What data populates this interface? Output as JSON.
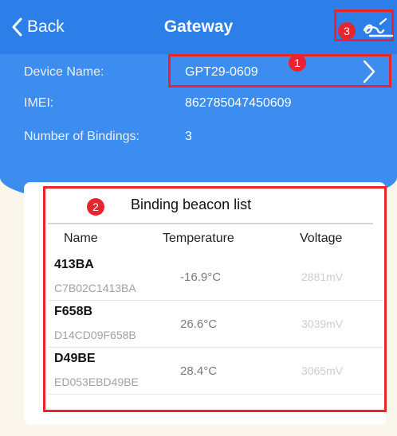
{
  "header": {
    "back_label": "Back",
    "title": "Gateway"
  },
  "callouts": {
    "one": "1",
    "two": "2",
    "three": "3"
  },
  "device": {
    "name_label": "Device Name:",
    "name_value": "GPT29-0609",
    "imei_label": "IMEI:",
    "imei_value": "862785047450609",
    "bindings_label": "Number of Bindings:",
    "bindings_value": "3"
  },
  "beacon_list": {
    "title": "Binding beacon list",
    "columns": [
      "Name",
      "Temperature",
      "Voltage"
    ],
    "rows": [
      {
        "name": "413BA",
        "mac": "C7B02C1413BA",
        "temperature": "-16.9°C",
        "voltage": "2881mV"
      },
      {
        "name": "F658B",
        "mac": "D14CD09F658B",
        "temperature": "26.6°C",
        "voltage": "3039mV"
      },
      {
        "name": "D49BE",
        "mac": "ED053EBD49BE",
        "temperature": "28.4°C",
        "voltage": "3065mV"
      }
    ]
  },
  "colors": {
    "header_blue": "#2c7fe9",
    "panel_blue": "#3d8df0",
    "callout_red": "#e8242e",
    "page_background": "#fbf6ec"
  },
  "icons": {
    "back": "chevron-left-icon",
    "edit": "edit-signature-icon",
    "device_name": "chevron-right-icon"
  }
}
